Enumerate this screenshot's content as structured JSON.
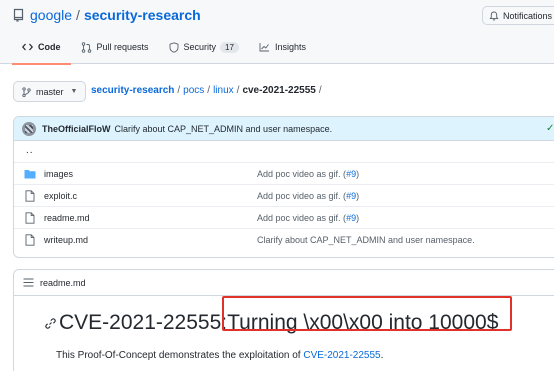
{
  "repo": {
    "owner": "google",
    "separator": "/",
    "name": "security-research"
  },
  "notifications": {
    "label": "Notifications"
  },
  "tabs": [
    {
      "label": "Code",
      "icon": "code-icon",
      "active": true
    },
    {
      "label": "Pull requests",
      "icon": "pull-request-icon",
      "active": false
    },
    {
      "label": "Security",
      "icon": "shield-icon",
      "active": false,
      "count": "17"
    },
    {
      "label": "Insights",
      "icon": "graph-icon",
      "active": false
    }
  ],
  "branch": {
    "label": "master",
    "icon": "branch-icon"
  },
  "breadcrumb": {
    "root": "security-research",
    "parts": [
      "pocs",
      "linux"
    ],
    "current": "cve-2021-22555",
    "sep": "/"
  },
  "commit": {
    "author": "TheOfficialFloW",
    "message": "Clarify about CAP_NET_ADMIN and user namespace.",
    "status_icon": "check-icon",
    "status_glyph": "✓"
  },
  "files": {
    "parent": "..",
    "rows": [
      {
        "type": "folder",
        "icon": "folder-icon",
        "name": "images",
        "msg": "Add poc video as gif. (",
        "msg_link": "#9",
        "msg_end": ")"
      },
      {
        "type": "file",
        "icon": "file-icon",
        "name": "exploit.c",
        "msg": "Add poc video as gif. (",
        "msg_link": "#9",
        "msg_end": ")"
      },
      {
        "type": "file",
        "icon": "file-icon",
        "name": "readme.md",
        "msg": "Add poc video as gif. (",
        "msg_link": "#9",
        "msg_end": ")"
      },
      {
        "type": "file",
        "icon": "file-icon",
        "name": "writeup.md",
        "msg": "Clarify about CAP_NET_ADMIN and user namespace.",
        "msg_link": "",
        "msg_end": ""
      }
    ]
  },
  "readme": {
    "filename": "readme.md",
    "title_prefix": "CVE-2021-22555: ",
    "title_highlight": "Turning \\x00\\x00 into 10000$",
    "para_before": "This Proof-Of-Concept demonstrates the exploitation of ",
    "para_link": "CVE-2021-22555",
    "para_after": ".",
    "highlight_color": "#e0322a"
  }
}
